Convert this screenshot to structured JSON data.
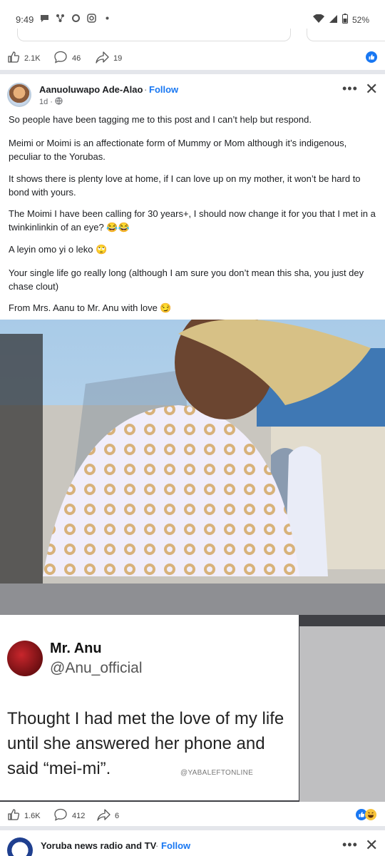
{
  "status_bar": {
    "time": "9:49",
    "battery": "52%"
  },
  "prev_post": {
    "likes": "2.1K",
    "comments": "46",
    "shares": "19"
  },
  "post": {
    "author": "Aanuoluwapo Ade-Alao",
    "separator": "·",
    "follow_label": "Follow",
    "time": "1d",
    "paragraphs": [
      "So people have been tagging me to this post and I can’t help but respond.",
      "Meimi or Moimi is an affectionate form of Mummy or Mom although it’s indigenous, peculiar to the Yorubas.",
      "It shows there is plenty love at home, if I can love up on my mother, it won’t be hard to bond with yours.",
      "The Moimi I have been calling for 30 years+, I should now change it for you that I met in a twinkinlinkin of an eye? 😂😂",
      "A leyin omo yi o leko 🙄",
      "Your single life go really long (although I am sure you don’t mean this sha, you just dey chase clout)",
      "From Mrs. Aanu to Mr. Anu with love 😏"
    ],
    "tweet": {
      "name": "Mr. Anu",
      "handle": "@Anu_official",
      "text": "Thought I had met the love of my life until she answered her phone and said “mei-mi”.",
      "watermark": "@YABALEFTONLINE"
    },
    "likes": "1.6K",
    "comments": "412",
    "shares": "6"
  },
  "next_post": {
    "author": "Yoruba news radio and TV",
    "separator": "·",
    "follow_label": "Follow"
  },
  "colors": {
    "accent": "#1877f2",
    "text": "#1c1e21",
    "muted": "#65676b"
  }
}
